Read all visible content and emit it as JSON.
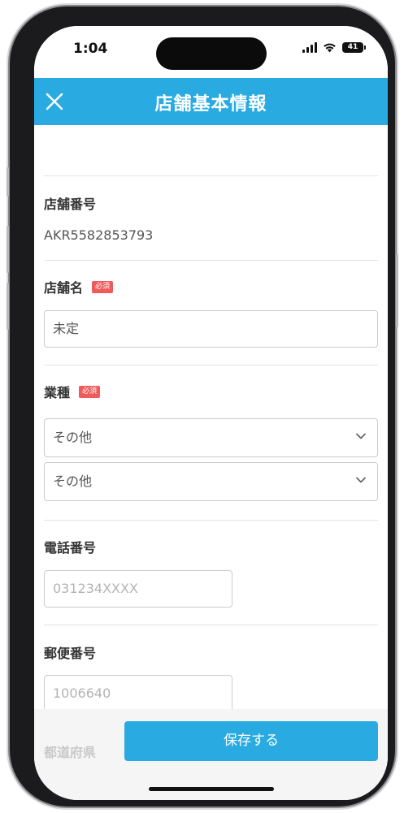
{
  "status_bar": {
    "time": "1:04",
    "battery": "41"
  },
  "header": {
    "title": "店舗基本情報"
  },
  "fields": {
    "store_number": {
      "label": "店舗番号",
      "value": "AKR5582853793"
    },
    "store_name": {
      "label": "店舗名",
      "required": "必須",
      "value": "未定"
    },
    "industry": {
      "label": "業種",
      "required": "必須",
      "select1": "その他",
      "select2": "その他"
    },
    "phone": {
      "label": "電話番号",
      "placeholder": "031234XXXX"
    },
    "postal": {
      "label": "郵便番号",
      "placeholder": "1006640"
    },
    "prefecture": {
      "label": "都道府県"
    }
  },
  "footer": {
    "save_label": "保存する"
  },
  "colors": {
    "accent": "#29abe2",
    "required_badge": "#ef5a5a"
  }
}
